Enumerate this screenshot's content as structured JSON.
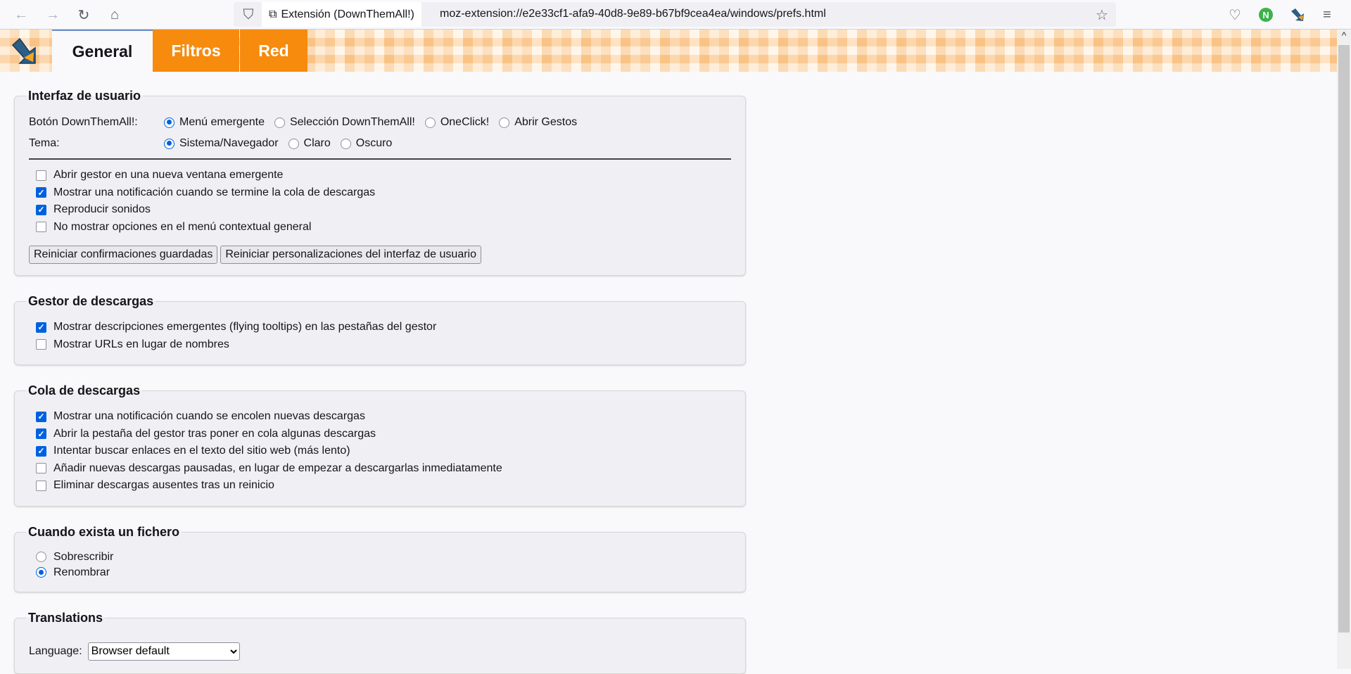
{
  "browser": {
    "identity": "Extensión (DownThemAll!)",
    "url": "moz-extension://e2e33cf1-afa9-40d8-9e89-b67bf9cea4ea/windows/prefs.html"
  },
  "tabs": [
    {
      "label": "General",
      "active": true
    },
    {
      "label": "Filtros"
    },
    {
      "label": "Red"
    }
  ],
  "colors": {
    "accent": "#0061e0",
    "tab_orange": "#f68b0e"
  },
  "ui": {
    "legend": "Interfaz de usuario",
    "button_label": "Botón DownThemAll!:",
    "button_options": [
      "Menú emergente",
      "Selección DownThemAll!",
      "OneClick!",
      "Abrir Gestos"
    ],
    "button_selected": "Menú emergente",
    "theme_label": "Tema:",
    "theme_options": [
      "Sistema/Navegador",
      "Claro",
      "Oscuro"
    ],
    "theme_selected": "Sistema/Navegador",
    "checks": [
      {
        "label": "Abrir gestor en una nueva ventana emergente",
        "checked": false
      },
      {
        "label": "Mostrar una notificación cuando se termine la cola de descargas",
        "checked": true
      },
      {
        "label": "Reproducir sonidos",
        "checked": true
      },
      {
        "label": "No mostrar opciones en el menú contextual general",
        "checked": false
      }
    ],
    "reset_confirmations": "Reiniciar confirmaciones guardadas",
    "reset_customizations": "Reiniciar personalizaciones del interfaz de usuario"
  },
  "manager": {
    "legend": "Gestor de descargas",
    "checks": [
      {
        "label": "Mostrar descripciones emergentes (flying tooltips) en las pestañas del gestor",
        "checked": true
      },
      {
        "label": "Mostrar URLs en lugar de nombres",
        "checked": false
      }
    ]
  },
  "queue": {
    "legend": "Cola de descargas",
    "checks": [
      {
        "label": "Mostrar una notificación cuando se encolen nuevas descargas",
        "checked": true
      },
      {
        "label": "Abrir la pestaña del gestor tras poner en cola algunas descargas",
        "checked": true
      },
      {
        "label": "Intentar buscar enlaces en el texto del sitio web (más lento)",
        "checked": true
      },
      {
        "label": "Añadir nuevas descargas pausadas, en lugar de empezar a descargarlas inmediatamente",
        "checked": false
      },
      {
        "label": "Eliminar descargas ausentes tras un reinicio",
        "checked": false
      }
    ]
  },
  "exists": {
    "legend": "Cuando exista un fichero",
    "options": [
      "Sobrescribir",
      "Renombrar"
    ],
    "selected": "Renombrar"
  },
  "translations": {
    "legend": "Translations",
    "language_label": "Language:",
    "language_value": "Browser default"
  }
}
